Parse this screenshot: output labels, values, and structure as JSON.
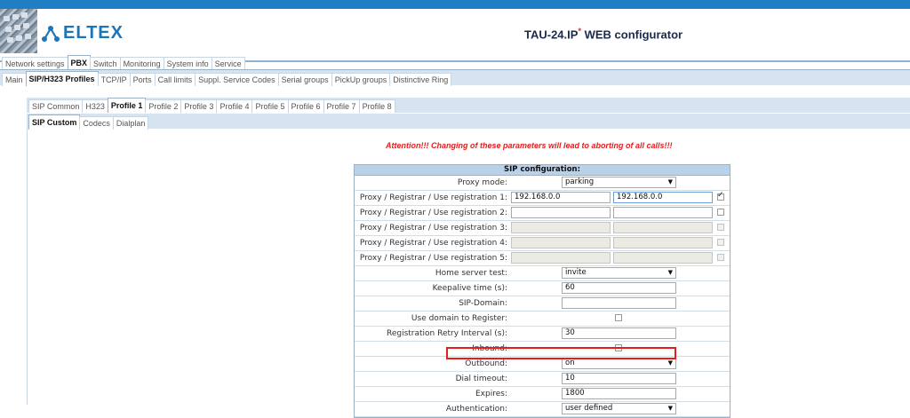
{
  "header": {
    "brand": "ELTEX",
    "device": "TAU-24.IP",
    "device_mark": "*",
    "suffix": "WEB configurator"
  },
  "nav": {
    "main_tabs": [
      "Network settings",
      "PBX",
      "Switch",
      "Monitoring",
      "System info",
      "Service"
    ],
    "main_active": "PBX",
    "sub_tabs": [
      "Main",
      "SIP/H323 Profiles",
      "TCP/IP",
      "Ports",
      "Call limits",
      "Suppl. Service Codes",
      "Serial groups",
      "PickUp groups",
      "Distinctive Ring"
    ],
    "sub_active": "SIP/H323 Profiles",
    "profile_tabs": [
      "SIP Common",
      "H323",
      "Profile 1",
      "Profile 2",
      "Profile 3",
      "Profile 4",
      "Profile 5",
      "Profile 6",
      "Profile 7",
      "Profile 8"
    ],
    "profile_active": "Profile 1",
    "section_tabs": [
      "SIP Custom",
      "Codecs",
      "Dialplan"
    ],
    "section_active": "SIP Custom"
  },
  "warning": "Attention!!! Changing of these parameters will lead to aborting of all calls!!!",
  "config": {
    "title": "SIP configuration:",
    "proxy_mode": {
      "label": "Proxy mode:",
      "value": "parking"
    },
    "proxies": [
      {
        "label": "Proxy / Registrar / Use registration 1:",
        "proxy": "192.168.0.0",
        "registrar": "192.168.0.0",
        "use_reg": true,
        "enabled": true
      },
      {
        "label": "Proxy / Registrar / Use registration 2:",
        "proxy": "",
        "registrar": "",
        "use_reg": false,
        "enabled": true
      },
      {
        "label": "Proxy / Registrar / Use registration 3:",
        "proxy": "",
        "registrar": "",
        "use_reg": false,
        "enabled": false
      },
      {
        "label": "Proxy / Registrar / Use registration 4:",
        "proxy": "",
        "registrar": "",
        "use_reg": false,
        "enabled": false
      },
      {
        "label": "Proxy / Registrar / Use registration 5:",
        "proxy": "",
        "registrar": "",
        "use_reg": false,
        "enabled": false
      }
    ],
    "home_server_test": {
      "label": "Home server test:",
      "value": "invite"
    },
    "keepalive": {
      "label": "Keepalive time (s):",
      "value": "60"
    },
    "sip_domain": {
      "label": "SIP-Domain:",
      "value": ""
    },
    "use_domain": {
      "label": "Use domain to Register:",
      "checked": false
    },
    "retry_interval": {
      "label": "Registration Retry Interval (s):",
      "value": "30"
    },
    "inbound": {
      "label": "Inbound:",
      "checked": false
    },
    "outbound": {
      "label": "Outbound:",
      "value": "on"
    },
    "dial_timeout": {
      "label": "Dial timeout:",
      "value": "10"
    },
    "expires": {
      "label": "Expires:",
      "value": "1800"
    },
    "authentication": {
      "label": "Authentication:",
      "value": "user defined"
    }
  },
  "colors": {
    "accent": "#1b75b8",
    "warning": "#e01f1f",
    "table_header": "#b9d2ea"
  }
}
